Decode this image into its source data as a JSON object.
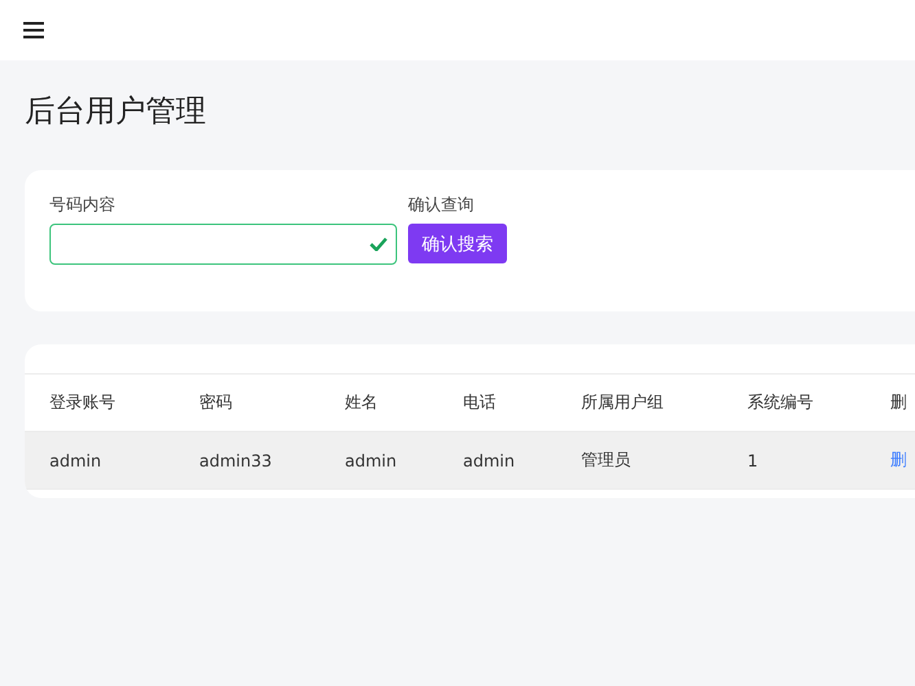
{
  "page_title": "后台用户管理",
  "search": {
    "label": "号码内容",
    "valid": true,
    "action_label": "确认查询",
    "button": "确认搜索"
  },
  "table": {
    "columns": [
      "登录账号",
      "密码",
      "姓名",
      "电话",
      "所属用户组",
      "系统编号",
      "删"
    ],
    "rows": [
      {
        "highlighted": true,
        "cells": [
          "admin",
          "admin33",
          "admin",
          "admin",
          "管理员",
          "1"
        ],
        "action": "删"
      }
    ]
  }
}
